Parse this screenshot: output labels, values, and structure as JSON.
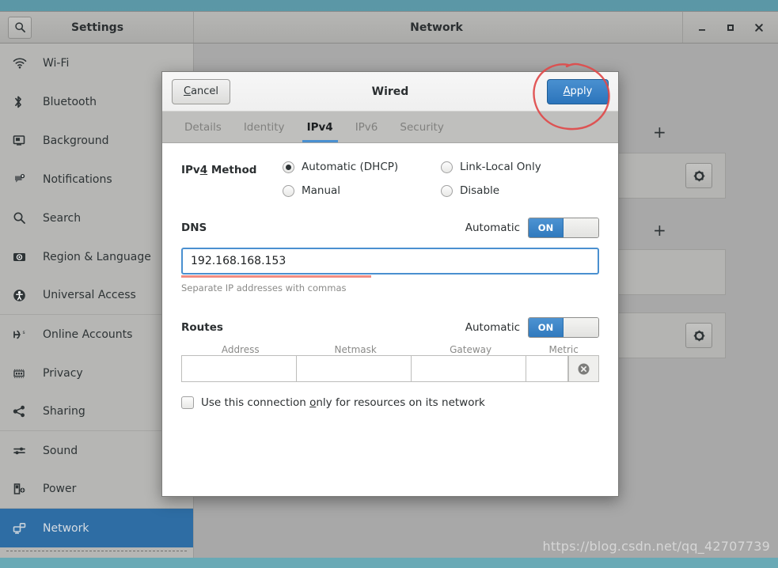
{
  "desktop": {
    "background_color": "#5b97a6",
    "watermark": "https://blog.csdn.net/qq_42707739"
  },
  "window": {
    "app_title": "Settings",
    "panel_title": "Network",
    "search_icon": "search-icon",
    "controls": {
      "minimize": "–",
      "maximize": "□",
      "close": "✕"
    }
  },
  "sidebar": {
    "items": [
      {
        "label": "Wi-Fi",
        "icon": "wifi-icon",
        "selected": false
      },
      {
        "label": "Bluetooth",
        "icon": "bluetooth-icon",
        "selected": false
      },
      {
        "label": "Background",
        "icon": "monitor-icon",
        "selected": false
      },
      {
        "label": "Notifications",
        "icon": "notification-icon",
        "selected": false
      },
      {
        "label": "Search",
        "icon": "search-icon",
        "selected": false
      },
      {
        "label": "Region & Language",
        "icon": "globe-keyboard-icon",
        "selected": false
      },
      {
        "label": "Universal Access",
        "icon": "accessibility-icon",
        "selected": false
      },
      {
        "label": "Online Accounts",
        "icon": "online-accounts-icon",
        "selected": false
      },
      {
        "label": "Privacy",
        "icon": "privacy-icon",
        "selected": false
      },
      {
        "label": "Sharing",
        "icon": "share-icon",
        "selected": false
      },
      {
        "label": "Sound",
        "icon": "sound-icon",
        "selected": false
      },
      {
        "label": "Power",
        "icon": "battery-icon",
        "selected": false
      },
      {
        "label": "Network",
        "icon": "network-icon",
        "selected": true
      }
    ],
    "selected_color": "#2e6da4"
  },
  "network_panel": {
    "add_button_label": "+",
    "gear_icon": "gear-icon"
  },
  "dialog": {
    "title": "Wired",
    "cancel_label": "Cancel",
    "cancel_accel": "C",
    "apply_label": "Apply",
    "apply_accel": "A",
    "apply_color": "#2b74bb",
    "tabs": [
      {
        "label": "Details",
        "active": false
      },
      {
        "label": "Identity",
        "active": false
      },
      {
        "label": "IPv4",
        "active": true
      },
      {
        "label": "IPv6",
        "active": false
      },
      {
        "label": "Security",
        "active": false
      }
    ],
    "ipv4_method": {
      "label_prefix": "IPv",
      "label_accel": "4",
      "label_suffix": " Method",
      "options": [
        {
          "label": "Automatic (DHCP)",
          "checked": true
        },
        {
          "label": "Link-Local Only",
          "checked": false
        },
        {
          "label": "Manual",
          "checked": false
        },
        {
          "label": "Disable",
          "checked": false
        }
      ]
    },
    "dns": {
      "heading": "DNS",
      "automatic_label": "Automatic",
      "toggle_state": "ON",
      "value": "192.168.168.153",
      "placeholder": "",
      "hint": "Separate IP addresses with commas",
      "validation_color": "#f08c82"
    },
    "routes": {
      "heading": "Routes",
      "automatic_label": "Automatic",
      "toggle_state": "ON",
      "columns": [
        "Address",
        "Netmask",
        "Gateway",
        "Metric"
      ],
      "rows": [
        {
          "address": "",
          "netmask": "",
          "gateway": "",
          "metric": ""
        }
      ],
      "delete_icon": "remove-circle-icon"
    },
    "restrict": {
      "text_before": "Use this connection ",
      "accel": "o",
      "text_after": "nly for resources on its network",
      "checked": false
    }
  },
  "annotation": {
    "type": "hand-drawn-circle",
    "color": "#e04a4a",
    "target": "apply-button"
  }
}
